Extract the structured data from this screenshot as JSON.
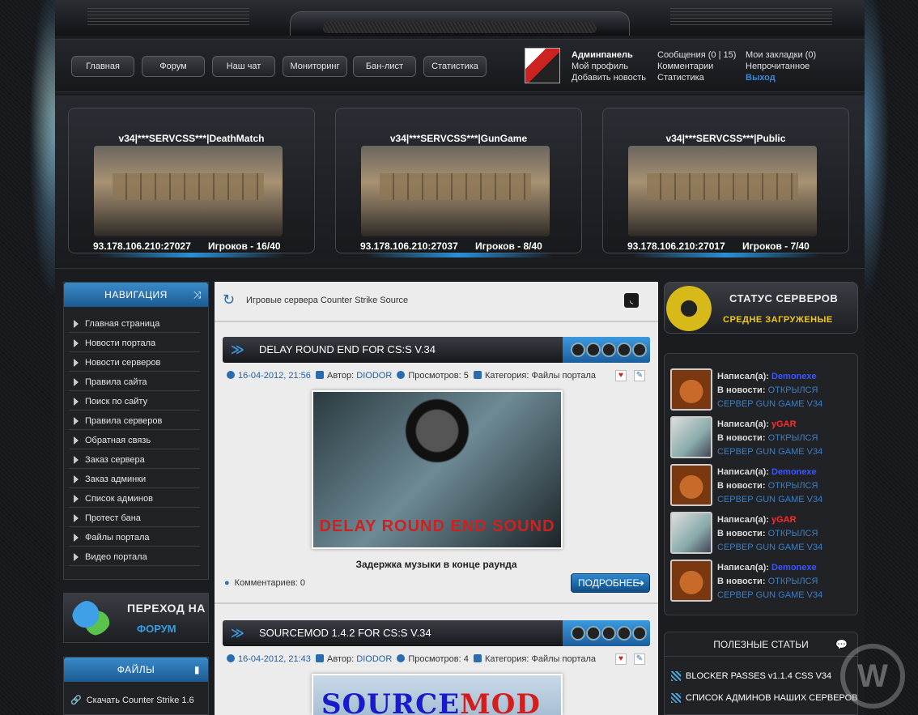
{
  "nav": {
    "items": [
      "Главная",
      "Форум",
      "Наш чат",
      "Мониторинг",
      "Бан-лист",
      "Статистика"
    ]
  },
  "user": {
    "admin": "Админпанель",
    "profile": "Мой профиль",
    "add_news": "Добавить новость",
    "messages": "Сообщения (0 | 15)",
    "comments": "Комментарии",
    "stats": "Статистика",
    "bookmarks": "Мои закладки (0)",
    "unread": "Непрочитанное",
    "logout": "Выход"
  },
  "servers": [
    {
      "name": "v34|***SERVCSS***|DeathMatch",
      "ip": "93.178.106.210:27027",
      "players": "Игроков - 16/40"
    },
    {
      "name": "v34|***SERVCSS***|GunGame",
      "ip": "93.178.106.210:27037",
      "players": "Игроков - 8/40"
    },
    {
      "name": "v34|***SERVCSS***|Public",
      "ip": "93.178.106.210:27017",
      "players": "Игроков - 7/40"
    }
  ],
  "sidebar": {
    "nav_title": "НАВИГАЦИЯ",
    "items": [
      "Главная страница",
      "Новости портала",
      "Новости серверов",
      "Правила сайта",
      "Поиск по сайту",
      "Правила серверов",
      "Обратная связь",
      "Заказ сервера",
      "Заказ админки",
      "Список админов",
      "Протест бана",
      "Файлы портала",
      "Видео портала"
    ],
    "forum_banner": {
      "line1": "ПЕРЕХОД НА",
      "line2": "ФОРУМ"
    },
    "files_title": "ФАЙЛЫ",
    "files_items": [
      "Скачать Counter Strike 1.6"
    ]
  },
  "main": {
    "breadcrumb": "Игровые сервера Counter Strike Source",
    "read_more": "ПОДРОБНЕЕ",
    "news": [
      {
        "title": "DELAY ROUND END FOR CS:S V.34",
        "date": "16-04-2012, 21:56",
        "author_label": "Автор:",
        "author": "DIODOR",
        "views": "Просмотров: 5",
        "category": "Категория: Файлы портала",
        "image_text": "DELAY ROUND END SOUND",
        "subtitle": "Задержка музыки в конце раунда",
        "comments": "Комментариев: 0"
      },
      {
        "title": "SOURCEMOD 1.4.2 FOR CS:S V.34",
        "date": "16-04-2012, 21:43",
        "author_label": "Автор:",
        "author": "DIODOR",
        "views": "Просмотров: 4",
        "category": "Категория: Файлы портала",
        "image_text_a": "SOURCE",
        "image_text_b": "MOD"
      }
    ]
  },
  "right": {
    "status_title": "СТАТУС СЕРВЕРОВ",
    "status_value": "СРЕДНЕ ЗАГРУЖЕНЫЕ",
    "comments": [
      {
        "wrote_label": "Написал(а):",
        "user": "Demonexe",
        "news_label": "В новости:",
        "news": "ОТКРЫЛСЯ СЕРВЕР GUN GAME V34"
      },
      {
        "wrote_label": "Написал(а):",
        "user": "yGAR",
        "news_label": "В новости:",
        "news": "ОТКРЫЛСЯ СЕРВЕР GUN GAME V34"
      },
      {
        "wrote_label": "Написал(а):",
        "user": "Demonexe",
        "news_label": "В новости:",
        "news": "ОТКРЫЛСЯ СЕРВЕР GUN GAME V34"
      },
      {
        "wrote_label": "Написал(а):",
        "user": "yGAR",
        "news_label": "В новости:",
        "news": "ОТКРЫЛСЯ СЕРВЕР GUN GAME V34"
      },
      {
        "wrote_label": "Написал(а):",
        "user": "Demonexe",
        "news_label": "В новости:",
        "news": "ОТКРЫЛСЯ СЕРВЕР GUN GAME V34"
      }
    ],
    "articles_title": "ПОЛЕЗНЫЕ СТАТЬИ",
    "articles": [
      "BLOCKER PASSES v1.1.4 CSS V34",
      "СПИСОК АДМИНОВ НАШИХ СЕРВЕРОВ"
    ]
  },
  "colors": {
    "accent_blue": "#2a6cb0",
    "header_blue": "#3a8bc9",
    "user_blue": "#3a55ff",
    "user_red": "#ff2b2b",
    "status_yellow": "#f0c81e"
  }
}
